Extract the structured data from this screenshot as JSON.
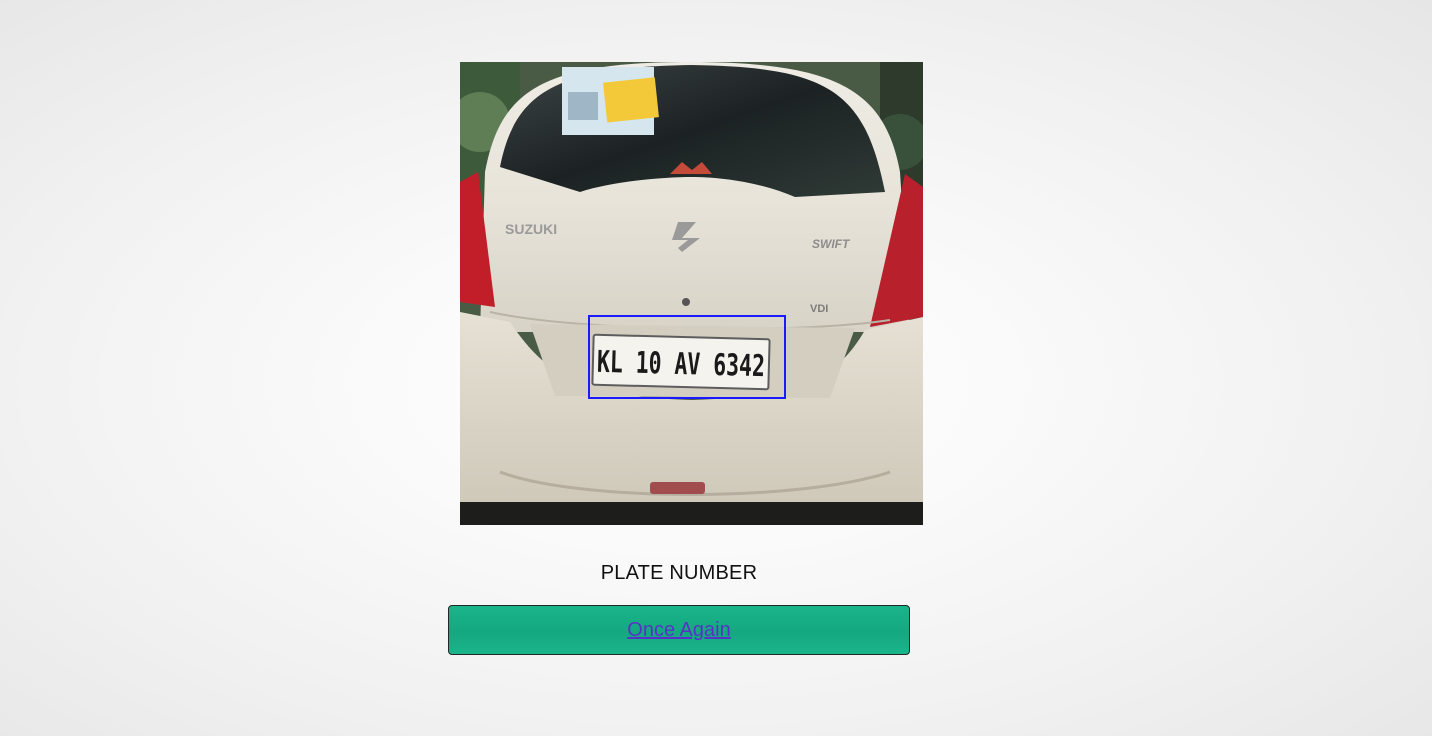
{
  "result": {
    "plate_label": "PLATE NUMBER",
    "again_label": "Once Again"
  },
  "photo": {
    "plate_text": "KL 10 AV 6342",
    "badge_left": "SUZUKI",
    "badge_right": "SWIFT",
    "badge_variant": "VDI",
    "detection_box_color": "#1a1aff"
  }
}
